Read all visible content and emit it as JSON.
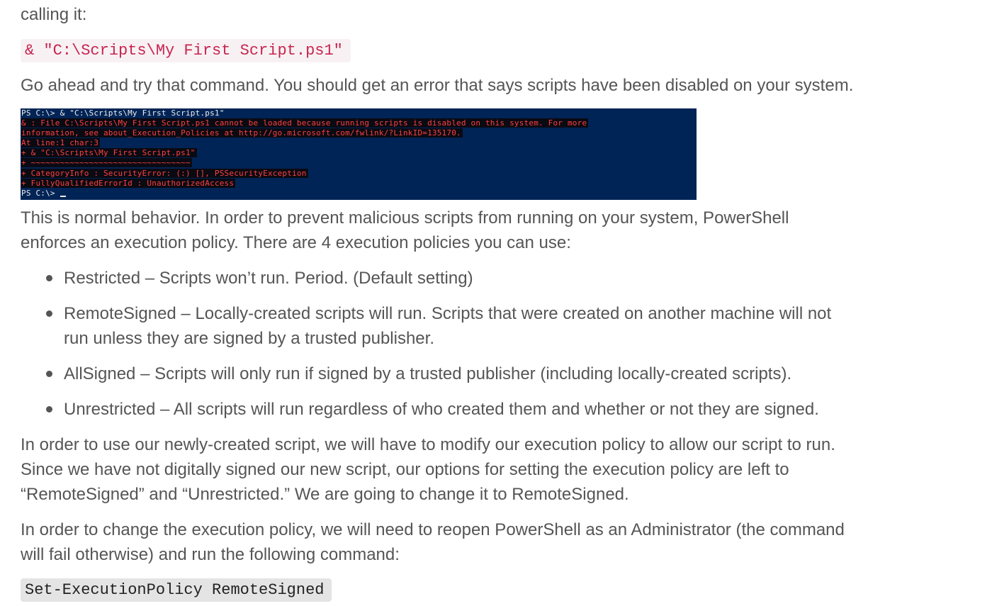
{
  "intro": {
    "partial_line": "calling it:",
    "command": "& \"C:\\Scripts\\My First Script.ps1\"",
    "try_text": "Go ahead and try that command. You should get an error that says scripts have been disabled on your system."
  },
  "terminal": {
    "prompt_line": "PS C:\\> & \"C:\\Scripts\\My First Script.ps1\"",
    "error_lines": [
      "& : File C:\\Scripts\\My First Script.ps1 cannot be loaded because running scripts is disabled on this system. For more",
      "information, see about_Execution_Policies at http://go.microsoft.com/fwlink/?LinkID=135170.",
      "At line:1 char:3",
      "+ & \"C:\\Scripts\\My First Script.ps1\"",
      "+   ~~~~~~~~~~~~~~~~~~~~~~~~~~~~~~~~~",
      "    + CategoryInfo          : SecurityError: (:) [], PSSecurityException",
      "    + FullyQualifiedErrorId : UnauthorizedAccess"
    ],
    "final_prompt": "PS C:\\> "
  },
  "explanation": {
    "line1": "This is normal behavior. In order to prevent malicious scripts from running on your system, PowerShell",
    "line2": "enforces an execution policy. There are 4 execution policies you can use:"
  },
  "policies": [
    {
      "lines": [
        "Restricted – Scripts won’t run. Period. (Default setting)"
      ]
    },
    {
      "lines": [
        "RemoteSigned – Locally-created scripts will run. Scripts that were created on another machine will not",
        "run unless they are signed by a trusted publisher."
      ]
    },
    {
      "lines": [
        "AllSigned – Scripts will only run if signed by a trusted publisher (including locally-created scripts)."
      ]
    },
    {
      "lines": [
        "Unrestricted – All scripts will run regardless of who created them and whether or not they are signed."
      ]
    }
  ],
  "modify_paragraph": {
    "line1": "In order to use our newly-created script, we will have to modify our execution policy to allow our script to run.",
    "line2": "Since we have not digitally signed our new script, our options for setting the execution policy are left to",
    "line3": "“RemoteSigned” and “Unrestricted.” We are going to change it to RemoteSigned."
  },
  "change_paragraph": {
    "line1": "In order to change the execution policy, we will need to reopen PowerShell as an Administrator (the command",
    "line2": "will fail otherwise) and run the following command:"
  },
  "final_command": "Set-ExecutionPolicy RemoteSigned",
  "colors": {
    "body_text": "#555555",
    "inline_code_red": "#c7254e",
    "inline_code_red_bg": "#f8f1f4",
    "code_gray_bg": "#e4e4e4",
    "terminal_bg": "#012456",
    "terminal_error": "#ff4040"
  }
}
